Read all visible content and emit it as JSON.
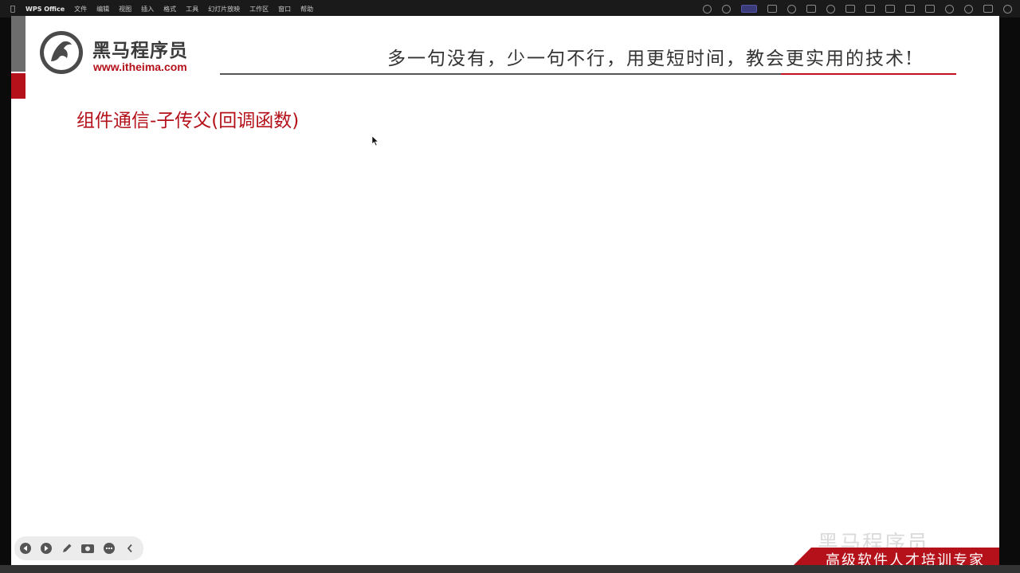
{
  "menubar": {
    "items": [
      "WPS Office",
      "文件",
      "编辑",
      "视图",
      "插入",
      "格式",
      "工具",
      "幻灯片放映",
      "工作区",
      "窗口",
      "帮助"
    ]
  },
  "slide": {
    "brand_name": "黑马程序员",
    "brand_url": "www.itheima.com",
    "slogan": "多一句没有，少一句不行，用更短时间，教会更实用的技术!",
    "title": "组件通信-子传父(回调函数)"
  },
  "toolbar": {
    "icons": [
      "prev-icon",
      "next-icon",
      "pen-icon",
      "camera-icon",
      "more-icon",
      "collapse-icon"
    ]
  },
  "footer": {
    "watermark": "黑马程序员",
    "banner": "高级软件人才培训专家"
  },
  "colors": {
    "brand_red": "#b4111a",
    "slide_bg": "#ffffff",
    "menubar_bg": "#1a1a1a"
  }
}
